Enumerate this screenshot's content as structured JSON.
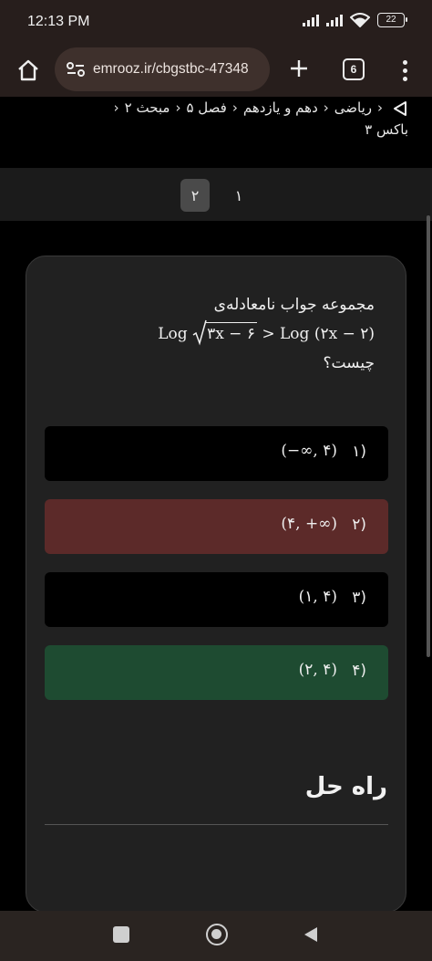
{
  "status_bar": {
    "time": "12:13 PM",
    "battery": "22"
  },
  "browser": {
    "url": "emrooz.ir/cbgstbc-47348",
    "tab_count": "6"
  },
  "breadcrumb": {
    "items": [
      "ریاضی",
      "دهم و یازدهم",
      "فصل ۵",
      "مبحث ۲"
    ],
    "tail": "باکس ۳"
  },
  "pager": {
    "pages": [
      "۱",
      "۲"
    ],
    "active": "۲"
  },
  "question": {
    "prefix": "مجموعه جواب نامعادله‌ی",
    "formula_left": "Log",
    "formula_sqrt": "۳x − ۶",
    "formula_right": " > Log (۲x − ۲)",
    "suffix": "چیست؟"
  },
  "options": [
    {
      "num": "۱)",
      "value": "(−∞, ۴)",
      "state": "neutral"
    },
    {
      "num": "۲)",
      "value": "(۴, +∞)",
      "state": "wrong"
    },
    {
      "num": "۳)",
      "value": "(۱, ۴)",
      "state": "neutral"
    },
    {
      "num": "۴)",
      "value": "(۲, ۴)",
      "state": "correct"
    }
  ],
  "solution": {
    "title": "راه حل"
  },
  "colors": {
    "wrong": "#5c2a29",
    "correct": "#1e4b31",
    "card": "#212121",
    "chrome": "#271e1c"
  }
}
